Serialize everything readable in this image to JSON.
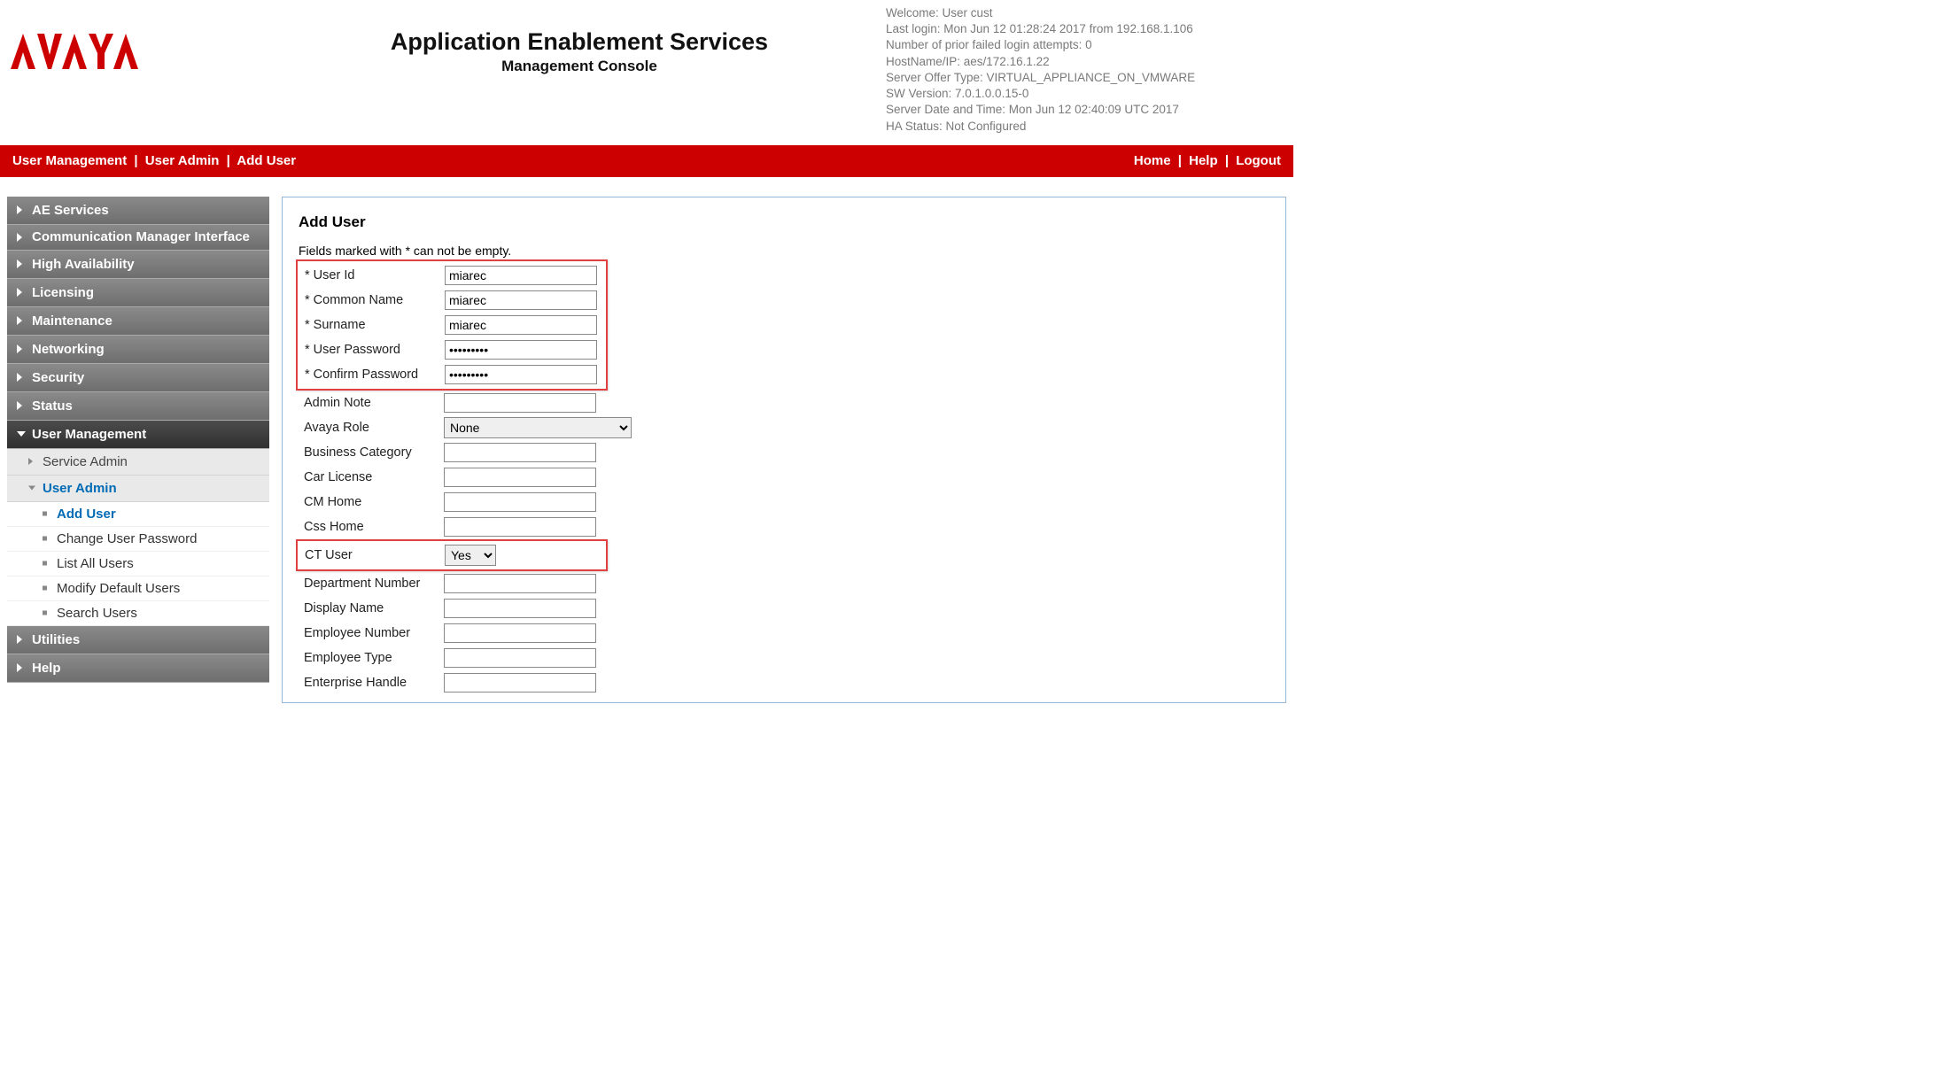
{
  "header": {
    "logo_text": "AVAYA",
    "main_title": "Application Enablement Services",
    "sub_title": "Management Console",
    "info_lines": [
      "Welcome: User cust",
      "Last login: Mon Jun 12 01:28:24 2017 from 192.168.1.106",
      "Number of prior failed login attempts: 0",
      "HostName/IP: aes/172.16.1.22",
      "Server Offer Type: VIRTUAL_APPLIANCE_ON_VMWARE",
      "SW Version: 7.0.1.0.0.15-0",
      "Server Date and Time: Mon Jun 12 02:40:09 UTC 2017",
      "HA Status: Not Configured"
    ]
  },
  "redbar": {
    "breadcrumb": [
      "User Management",
      "User Admin",
      "Add User"
    ],
    "right": [
      "Home",
      "Help",
      "Logout"
    ]
  },
  "sidebar": {
    "items": [
      {
        "label": "AE Services"
      },
      {
        "label": "Communication Manager Interface"
      },
      {
        "label": "High Availability"
      },
      {
        "label": "Licensing"
      },
      {
        "label": "Maintenance"
      },
      {
        "label": "Networking"
      },
      {
        "label": "Security"
      },
      {
        "label": "Status"
      },
      {
        "label": "User Management"
      },
      {
        "label": "Utilities"
      },
      {
        "label": "Help"
      }
    ],
    "user_mgmt_sub": [
      {
        "label": "Service Admin"
      },
      {
        "label": "User Admin"
      }
    ],
    "user_admin_sub": [
      {
        "label": "Add User"
      },
      {
        "label": "Change User Password"
      },
      {
        "label": "List All Users"
      },
      {
        "label": "Modify Default Users"
      },
      {
        "label": "Search Users"
      }
    ]
  },
  "panel": {
    "heading": "Add User",
    "note": "Fields marked with * can not be empty.",
    "fields": {
      "user_id": {
        "label": "* User Id",
        "value": "miarec"
      },
      "common_name": {
        "label": "* Common Name",
        "value": "miarec"
      },
      "surname": {
        "label": "* Surname",
        "value": "miarec"
      },
      "user_password": {
        "label": "* User Password",
        "value": "•••••••••"
      },
      "confirm_password": {
        "label": "* Confirm Password",
        "value": "•••••••••"
      },
      "admin_note": {
        "label": "Admin Note",
        "value": ""
      },
      "avaya_role": {
        "label": "Avaya Role",
        "value": "None"
      },
      "business_category": {
        "label": "Business Category",
        "value": ""
      },
      "car_license": {
        "label": "Car License",
        "value": ""
      },
      "cm_home": {
        "label": "CM Home",
        "value": ""
      },
      "css_home": {
        "label": "Css Home",
        "value": ""
      },
      "ct_user": {
        "label": "CT User",
        "value": "Yes"
      },
      "department_number": {
        "label": "Department Number",
        "value": ""
      },
      "display_name": {
        "label": "Display Name",
        "value": ""
      },
      "employee_number": {
        "label": "Employee Number",
        "value": ""
      },
      "employee_type": {
        "label": "Employee Type",
        "value": ""
      },
      "enterprise_handle": {
        "label": "Enterprise Handle",
        "value": ""
      }
    }
  }
}
